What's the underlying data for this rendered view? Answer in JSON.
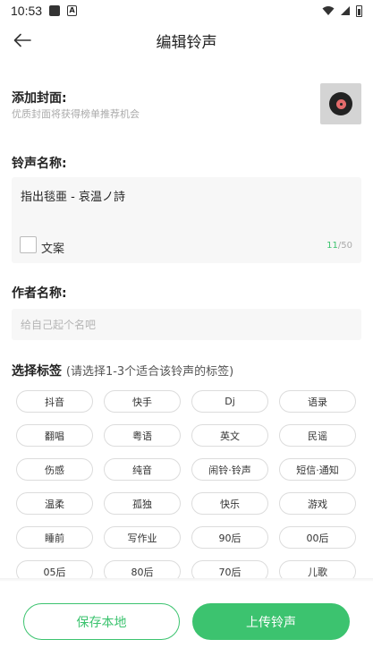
{
  "status_bar": {
    "time": "10:53",
    "icons": [
      "notification-square-icon",
      "a-app-icon",
      "wifi-icon",
      "signal-icon",
      "battery-icon"
    ]
  },
  "app_bar": {
    "title": "编辑铃声",
    "back_icon": "arrow-left-icon"
  },
  "cover": {
    "label": "添加封面:",
    "hint": "优质封面将获得榜单推荐机会",
    "thumb_icon": "vinyl-disc-icon"
  },
  "ringtone_name": {
    "label": "铃声名称:",
    "value": "指出毯亜 - 哀温ノ詩",
    "copy_checkbox_label": "文案",
    "count_used": "11",
    "count_max": "/50"
  },
  "author": {
    "label": "作者名称:",
    "placeholder": "给自己起个名吧"
  },
  "tags": {
    "label": "选择标签",
    "hint": "(请选择1-3个适合该铃声的标签)",
    "items": [
      "抖音",
      "快手",
      "Dj",
      "语录",
      "翻唱",
      "粤语",
      "英文",
      "民谣",
      "伤感",
      "纯音",
      "闹铃·铃声",
      "短信·通知",
      "温柔",
      "孤独",
      "快乐",
      "游戏",
      "睡前",
      "写作业",
      "90后",
      "00后",
      "05后",
      "80后",
      "70后",
      "儿歌"
    ]
  },
  "actions": {
    "save_label": "保存本地",
    "upload_label": "上传铃声"
  },
  "colors": {
    "accent": "#3cc36f",
    "field_bg": "#f7f7f7",
    "hint_text": "#aaaaaa"
  }
}
